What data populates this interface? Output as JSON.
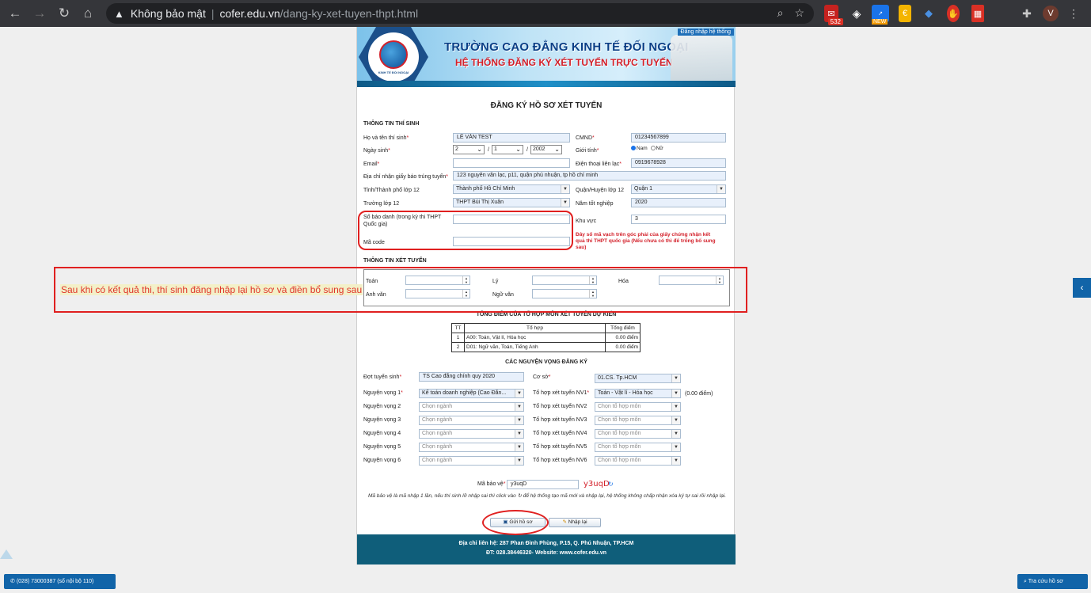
{
  "browser": {
    "security_label": "Không bảo mật",
    "url_host": "cofer.edu.vn",
    "url_path": "/dang-ky-xet-tuyen-thpt.html",
    "ext_mail_count": "532",
    "ext_new_label": "NEW",
    "avatar_letter": "V"
  },
  "header": {
    "title1": "TRƯỜNG CAO ĐẲNG KINH TẾ ĐỐI NGOẠI",
    "title2": "HỆ THỐNG ĐĂNG KÝ XÉT TUYỂN TRỰC TUYẾN",
    "login_link": "Đăng nhập hệ thống",
    "logo_caption": "KINH TẾ ĐỐI NGOẠI"
  },
  "form": {
    "title": "ĐĂNG KÝ HỒ SƠ XÉT TUYỂN",
    "section_candidate": "THÔNG TIN THÍ SINH",
    "full_name_label": "Họ và tên thí sinh",
    "full_name": "LÊ VĂN TEST",
    "id_label": "CMND",
    "id_value": "01234567899",
    "dob_label": "Ngày sinh",
    "dob_day": "2",
    "dob_month": "1",
    "dob_year": "2002",
    "dob_sep": "/",
    "gender_label": "Giới tính",
    "gender_male": "Nam",
    "gender_female": "Nữ",
    "email_label": "Email",
    "email_value": "",
    "phone_label": "Điện thoại liên lạc",
    "phone_value": "0919678928",
    "address_label": "Địa chỉ nhận giấy báo trúng tuyển",
    "address_value": "123 nguyễn văn lạc, p11, quận phú nhuận, tp hồ chí minh",
    "province_label": "Tỉnh/Thành phố lớp 12",
    "province_value": "Thành phố Hồ Chí Minh",
    "district_label": "Quận/Huyện lớp 12",
    "district_value": "Quận 1",
    "school_label": "Trường lớp 12",
    "school_value": "THPT Bùi Thị Xuân",
    "grad_year_label": "Năm tốt nghiệp",
    "grad_year_value": "2020",
    "sbd_label_1": "Số báo danh (trong kỳ thi THPT",
    "sbd_label_2": "Quốc gia)",
    "region_label": "Khu vực",
    "region_value": "3",
    "code_label": "Mã code",
    "code_note_1": "Đây số mã vạch trên góc phải của giấy chứng nhận kết",
    "code_note_2": "quả thi THPT quốc gia (Nếu chưa có thì để trống bổ sung",
    "code_note_3": "sau)"
  },
  "scores": {
    "section": "THÔNG TIN XÉT TUYỂN",
    "toan": "Toán",
    "ly": "Lý",
    "hoa": "Hóa",
    "anh": "Anh văn",
    "van": "Ngữ văn"
  },
  "combo_table": {
    "title": "TỔNG ĐIỂM CỦA TỔ HỢP MÔN XÉT TUYỂN DỰ KIẾN",
    "headers": [
      "TT",
      "Tổ hợp",
      "Tổng điểm"
    ],
    "rows": [
      [
        "1",
        "A00: Toán, Vật lí, Hóa học",
        "0.00 điểm"
      ],
      [
        "2",
        "D01: Ngữ văn, Toán, Tiếng Anh",
        "0.00 điểm"
      ]
    ]
  },
  "wishes": {
    "title": "CÁC NGUYỆN VỌNG ĐĂNG KÝ",
    "round_label": "Đợt tuyển sinh",
    "round_value": "TS Cao đẳng chính quy 2020",
    "campus_label": "Cơ sở",
    "campus_value": "01.CS. Tp.HCM",
    "nv_labels": [
      "Nguyện vọng 1",
      "Nguyện vọng 2",
      "Nguyện vọng 3",
      "Nguyện vọng 4",
      "Nguyện vọng 5",
      "Nguyện vọng 6"
    ],
    "nv_values": [
      "Kế toán doanh nghiệp (Cao Đẳn...",
      "Chọn ngành",
      "Chọn ngành",
      "Chọn ngành",
      "Chọn ngành",
      "Chọn ngành"
    ],
    "th_labels": [
      "Tổ hợp xét tuyển NV1",
      "Tổ hợp xét tuyển NV2",
      "Tổ hợp xét tuyển NV3",
      "Tổ hợp xét tuyển NV4",
      "Tổ hợp xét tuyển NV5",
      "Tổ hợp xét tuyển NV6"
    ],
    "th_values": [
      "Toán - Vật lí - Hóa học",
      "Chọn tổ hợp môn",
      "Chọn tổ hợp môn",
      "Chọn tổ hợp môn",
      "Chọn tổ hợp môn",
      "Chọn tổ hợp môn"
    ],
    "nv1_points": "(0.00 điểm)"
  },
  "captcha": {
    "label": "Mã bảo vệ",
    "input_value": "y3uqD",
    "image_text": "y3uqD",
    "note": "Mã bảo vệ là mã nhập 1 lần, nếu thí sinh lỡ nhập sai thì click vào ↻ để hệ thống tạo mã mới và nhập lại, hệ thống không chấp nhận xóa ký tự sai rồi nhập lại."
  },
  "buttons": {
    "submit": "Gửi hồ sơ",
    "reset": "Nhập lại"
  },
  "footer": {
    "address": "Địa chỉ liên hệ: 287 Phan Đình Phùng, P.15, Q. Phú Nhuận, TP.HCM",
    "contact": "ĐT: 028.38446320- Website: www.cofer.edu.vn"
  },
  "annotation": {
    "note": "Sau khi có kết quả thi, thí sinh đăng nhập lại hồ sơ và điền bổ sung sau"
  },
  "widgets": {
    "call_label": "(028) 73000387 (số nội bộ 110)",
    "lookup_label": "Tra cứu hồ sơ"
  }
}
